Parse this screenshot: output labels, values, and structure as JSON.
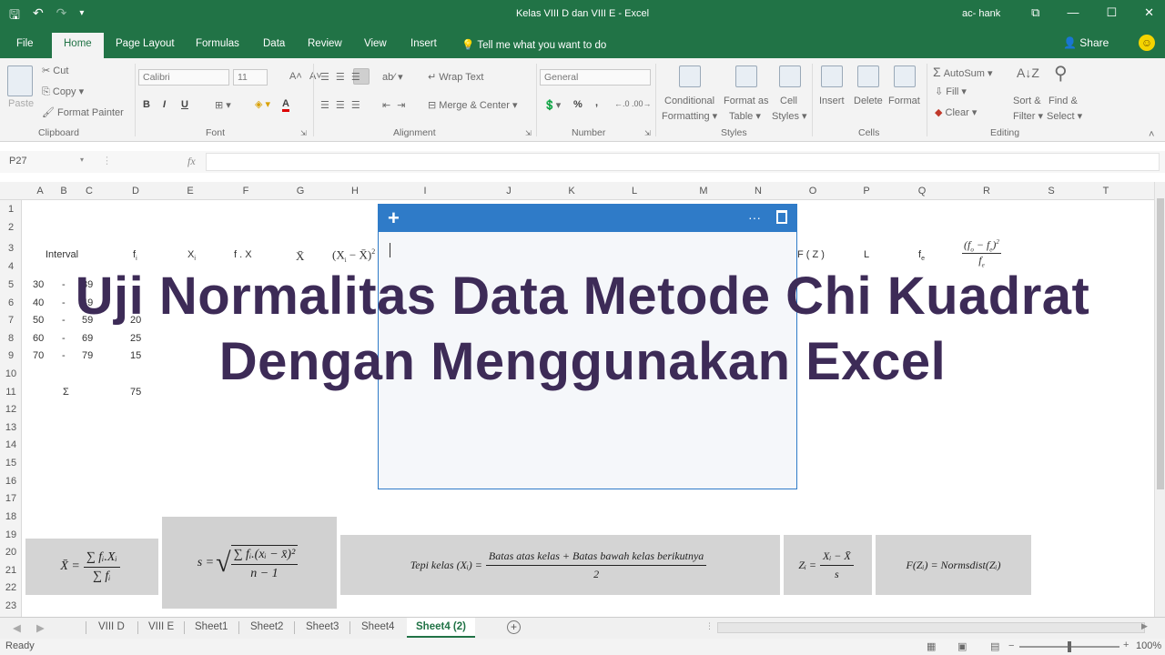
{
  "window": {
    "title": "Kelas VIII D dan VIII E  -  Excel",
    "user": "ac- hank"
  },
  "tabs": [
    "File",
    "Home",
    "Page Layout",
    "Formulas",
    "Data",
    "Review",
    "View",
    "Insert"
  ],
  "active_tab": "Home",
  "tell_me": "Tell me what you want to do",
  "share": "Share",
  "ribbon": {
    "clipboard": {
      "paste": "Paste",
      "cut": "Cut",
      "copy": "Copy",
      "format_painter": "Format Painter",
      "label": "Clipboard"
    },
    "font": {
      "name": "Calibri",
      "size": "11",
      "bold": "B",
      "italic": "I",
      "underline": "U",
      "color_letter": "A",
      "label": "Font"
    },
    "alignment": {
      "wrap": "Wrap Text",
      "merge": "Merge & Center",
      "label": "Alignment"
    },
    "number": {
      "format": "General",
      "percent": "%",
      "comma": ",",
      "label": "Number"
    },
    "styles": {
      "conditional": "Conditional",
      "formatting": "Formatting",
      "format_as": "Format as",
      "table": "Table",
      "cell": "Cell",
      "styles_word": "Styles",
      "label": "Styles"
    },
    "cells": {
      "insert": "Insert",
      "delete": "Delete",
      "format": "Format",
      "label": "Cells"
    },
    "editing": {
      "autosum": "AutoSum",
      "fill": "Fill",
      "clear": "Clear",
      "sort": "Sort &",
      "filter": "Filter",
      "find": "Find &",
      "select": "Select",
      "label": "Editing"
    }
  },
  "formula_bar": {
    "name_box": "P27",
    "fx": "fx"
  },
  "columns": [
    "A",
    "B",
    "C",
    "D",
    "E",
    "F",
    "G",
    "H",
    "I",
    "J",
    "K",
    "L",
    "M",
    "N",
    "O",
    "P",
    "Q",
    "R",
    "S",
    "T"
  ],
  "rows": [
    "1",
    "2",
    "3",
    "4",
    "5",
    "6",
    "7",
    "8",
    "9",
    "10",
    "11",
    "12",
    "13",
    "14",
    "15",
    "16",
    "17",
    "18",
    "19",
    "20",
    "21",
    "22",
    "23"
  ],
  "table": {
    "headers": {
      "interval": "Interval",
      "f": "f",
      "fsub": "i",
      "x": "X",
      "xsub": "i",
      "fx": "f . X",
      "fxsub1": "i",
      "fxsub2": "i",
      "xbar": "X̄",
      "xdev": "(X",
      "xdevsub": "i",
      "xdev2": " − X̄)",
      "sq": "2",
      "fz": "F ( Z )",
      "L": "L",
      "fe": "f",
      "fesub": "e"
    },
    "rows": [
      {
        "lo": "30",
        "dash": "-",
        "hi": "39",
        "f": ""
      },
      {
        "lo": "40",
        "dash": "-",
        "hi": "49",
        "f": ""
      },
      {
        "lo": "50",
        "dash": "-",
        "hi": "59",
        "f": "20"
      },
      {
        "lo": "60",
        "dash": "-",
        "hi": "69",
        "f": "25"
      },
      {
        "lo": "70",
        "dash": "-",
        "hi": "79",
        "f": "15"
      }
    ],
    "sigma": "Σ",
    "total": "75",
    "chi_num": "(f",
    "chi_num_o": "o",
    "chi_num_mid": " − f",
    "chi_num_e": "e",
    "chi_num_end": ")",
    "chi_sq": "2",
    "chi_den": "f",
    "chi_den_e": "e"
  },
  "formulas": {
    "mean_lhs": "X̄ =",
    "mean_num": "∑ fᵢ.Xᵢ",
    "mean_den": "∑ fᵢ",
    "sd_lhs": "s =",
    "sd_num": "∑ fᵢ.(xᵢ − x̄)²",
    "sd_den": "n − 1",
    "tepi_lhs": "Tepi kelas (Xᵢ) =",
    "tepi_num": "Batas atas kelas + Batas bawah kelas berikutnya",
    "tepi_den": "2",
    "z_lhs": "Zᵢ =",
    "z_num": "Xᵢ − X̄",
    "z_den": "s",
    "f_formula": "F(Zᵢ) = Normsdist(Zᵢ)"
  },
  "note": {
    "plus": "+",
    "more": "···"
  },
  "overlay": {
    "line1": "Uji Normalitas Data Metode Chi Kuadrat",
    "line2": "Dengan Menggunakan Excel"
  },
  "sheets": [
    "VIII D",
    "VIII E",
    "Sheet1",
    "Sheet2",
    "Sheet3",
    "Sheet4",
    "Sheet4 (2)"
  ],
  "active_sheet": "Sheet4 (2)",
  "status": {
    "ready": "Ready",
    "zoom": "100%"
  },
  "colors": {
    "excel_green": "#217346",
    "note_blue": "#2f7bc8",
    "overlay_text": "#3d2b57"
  }
}
